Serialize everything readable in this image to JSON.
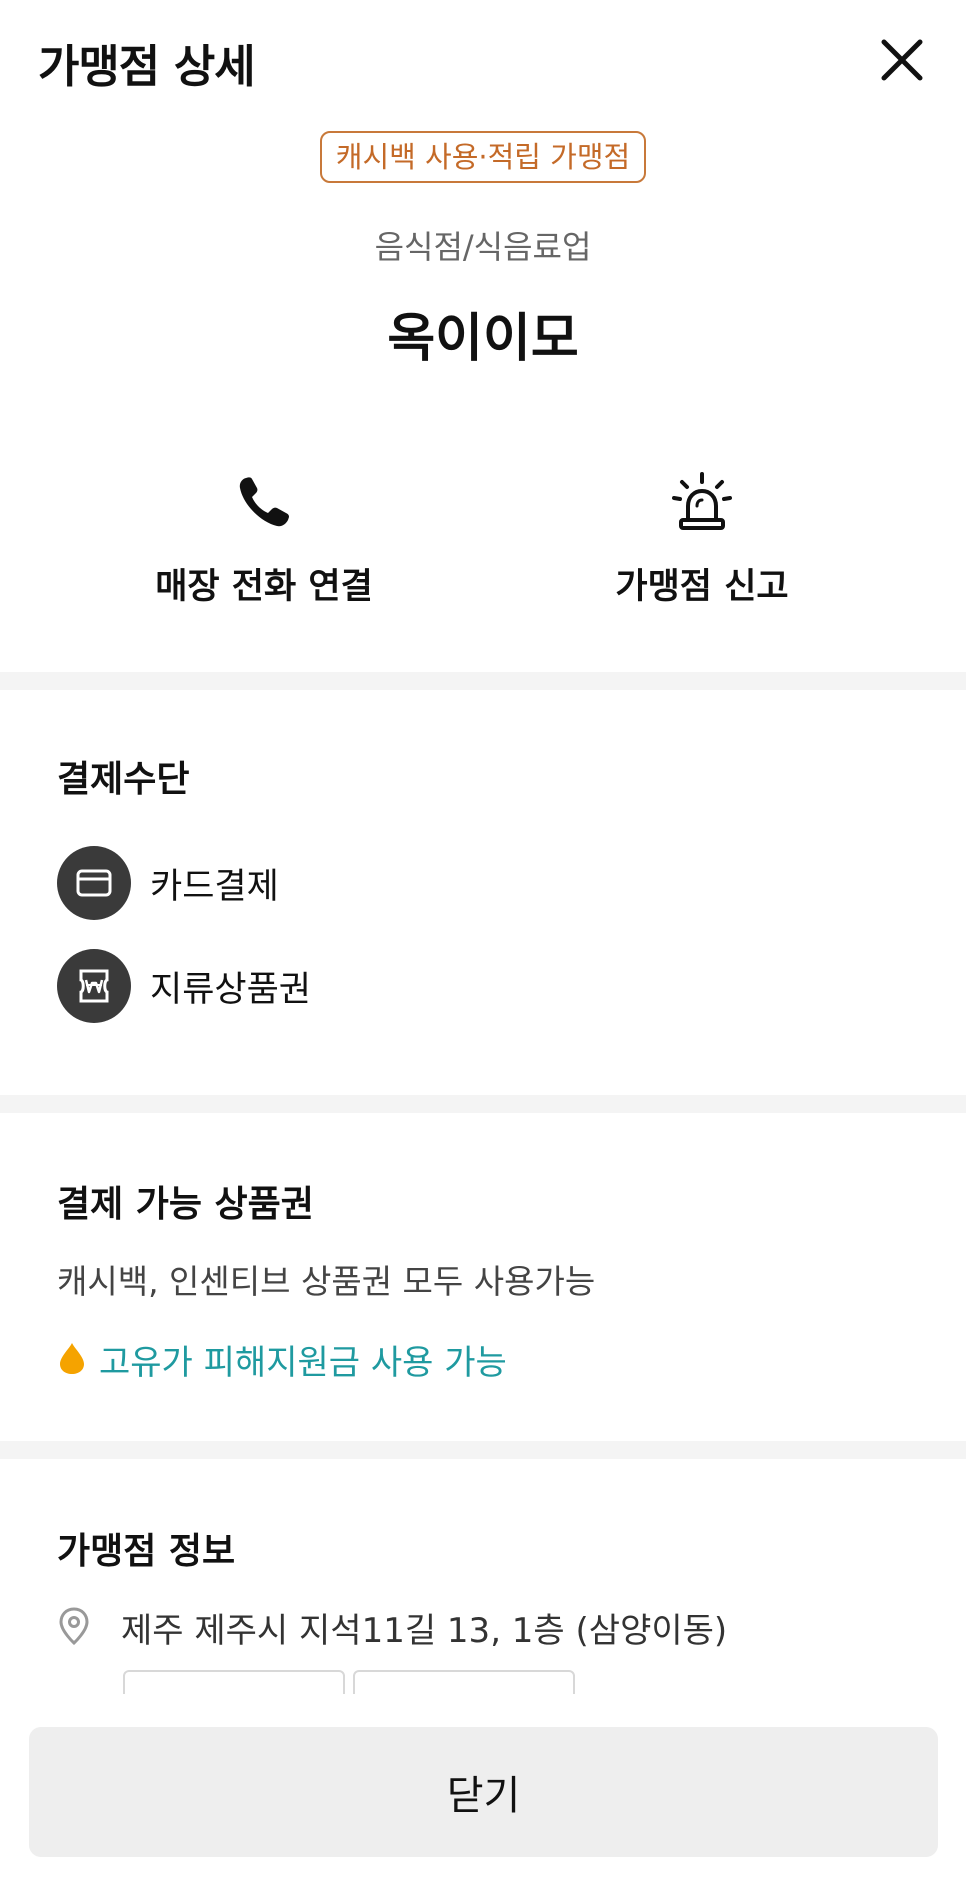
{
  "header": {
    "title": "가맹점 상세",
    "close_icon": "close-icon"
  },
  "merchant": {
    "badge": "캐시백 사용·적립 가맹점",
    "category": "음식점/식음료업",
    "name": "옥이이모"
  },
  "actions": [
    {
      "label": "매장 전화 연결",
      "icon": "phone-icon"
    },
    {
      "label": "가맹점 신고",
      "icon": "siren-icon"
    }
  ],
  "payment": {
    "title": "결제수단",
    "methods": [
      {
        "label": "카드결제",
        "icon": "card-icon"
      },
      {
        "label": "지류상품권",
        "icon": "won-voucher-icon"
      }
    ]
  },
  "vouchers": {
    "title": "결제 가능 상품권",
    "description": "캐시백, 인센티브 상품권 모두 사용가능",
    "relief_fund": "고유가 피해지원금 사용 가능"
  },
  "info": {
    "title": "가맹점 정보",
    "address": "제주 제주시 지석11길 13, 1층 (삼양이동)"
  },
  "footer": {
    "close_label": "닫기"
  },
  "colors": {
    "badge": "#c46a28",
    "relief_text": "#1f9aa0",
    "drop_icon": "#f5a300",
    "icon_circle": "#3a3a3a"
  }
}
